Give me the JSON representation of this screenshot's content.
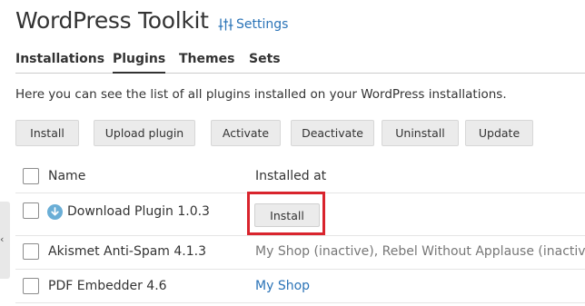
{
  "header": {
    "title": "WordPress Toolkit",
    "settings_label": "Settings",
    "settings_icon": "sliders-icon"
  },
  "tabs": [
    {
      "label": "Installations",
      "active": false
    },
    {
      "label": "Plugins",
      "active": true
    },
    {
      "label": "Themes",
      "active": false
    },
    {
      "label": "Sets",
      "active": false
    }
  ],
  "intro_text": "Here you can see the list of all plugins installed on your WordPress installations.",
  "toolbar": {
    "install": "Install",
    "upload_plugin": "Upload plugin",
    "activate": "Activate",
    "deactivate": "Deactivate",
    "uninstall": "Uninstall",
    "update": "Update"
  },
  "table": {
    "columns": {
      "name": "Name",
      "installed_at": "Installed at"
    },
    "rows": [
      {
        "name": "Download Plugin 1.0.3",
        "icon": "download-circle-icon",
        "installed_at": "",
        "action": "Install",
        "highlighted": true
      },
      {
        "name": "Akismet Anti-Spam 4.1.3",
        "installed_at": "My Shop (inactive), Rebel Without Applause (inactive)"
      },
      {
        "name": "PDF Embedder 4.6",
        "installed_at": "My Shop"
      }
    ]
  },
  "colors": {
    "link": "#2a73b7",
    "highlight": "#d9242d",
    "download_icon": "#6aaed6",
    "button_bg": "#ebebeb"
  },
  "side_handle_glyph": "‹"
}
